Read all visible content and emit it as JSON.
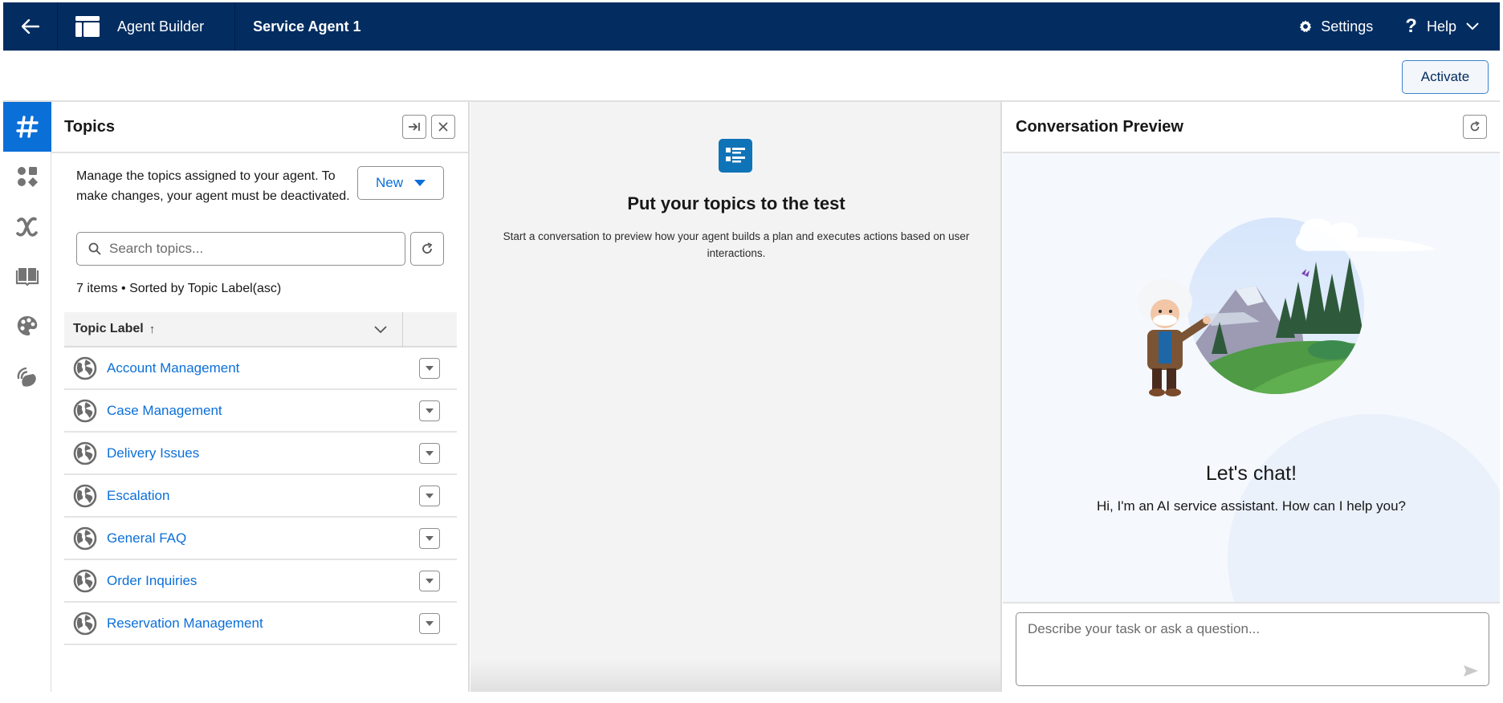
{
  "header": {
    "app_name": "Agent Builder",
    "agent_name": "Service Agent 1",
    "settings_label": "Settings",
    "help_label": "Help",
    "back_icon": "arrow-left-icon",
    "app_icon": "layout-icon",
    "colors": {
      "header_bg": "#032d60",
      "accent": "#0b6fd8"
    }
  },
  "toolbar": {
    "activate_label": "Activate"
  },
  "rail": {
    "items": [
      {
        "name": "topics",
        "icon": "hashtag-icon",
        "active": true
      },
      {
        "name": "components",
        "icon": "shapes-icon",
        "active": false
      },
      {
        "name": "variables",
        "icon": "formula-x-icon",
        "active": false
      },
      {
        "name": "knowledge",
        "icon": "book-icon",
        "active": false
      },
      {
        "name": "appearance",
        "icon": "palette-icon",
        "active": false
      },
      {
        "name": "connections",
        "icon": "signal-icon",
        "active": false
      }
    ]
  },
  "topics": {
    "title": "Topics",
    "description": "Manage the topics assigned to your agent. To make changes, your agent must be deactivated.",
    "new_label": "New",
    "search_placeholder": "Search topics...",
    "search_value": "",
    "items_info": "7 items • Sorted by Topic Label(asc)",
    "column_header": "Topic Label",
    "sort_indicator": "↑",
    "rows": [
      {
        "label": "Account Management"
      },
      {
        "label": "Case Management"
      },
      {
        "label": "Delivery Issues"
      },
      {
        "label": "Escalation"
      },
      {
        "label": "General FAQ"
      },
      {
        "label": "Order Inquiries"
      },
      {
        "label": "Reservation Management"
      }
    ]
  },
  "middle": {
    "title": "Put your topics to the test",
    "description": "Start a conversation to preview how your agent builds a plan and executes actions based on user interactions."
  },
  "preview": {
    "title": "Conversation Preview",
    "chat_title": "Let's chat!",
    "chat_subtitle": "Hi, I'm an AI service assistant. How can I help you?",
    "input_placeholder": "Describe your task or ask a question...",
    "input_value": ""
  }
}
